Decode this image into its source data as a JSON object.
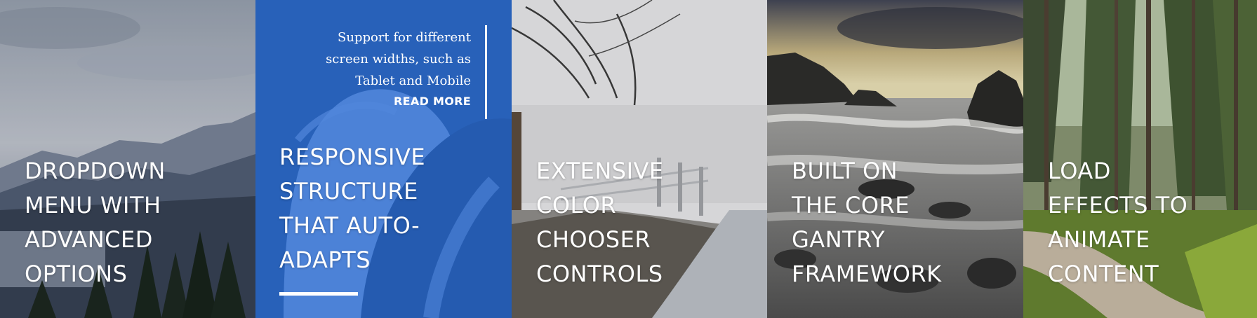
{
  "panels": [
    {
      "id": "p1",
      "title_lines": [
        "DROPDOWN",
        "MENU WITH",
        "ADVANCED",
        "OPTIONS"
      ],
      "scene": "mountain-lake-image"
    },
    {
      "id": "p2",
      "title_lines": [
        "RESPONSIVE",
        "STRUCTURE",
        "THAT AUTO-",
        "ADAPTS"
      ],
      "scene": "horse-image",
      "blurb_lines": [
        "Support for different",
        "screen widths, such as",
        "Tablet and Mobile"
      ],
      "read_more": "READ MORE",
      "overlay_color": "#2468d2"
    },
    {
      "id": "p3",
      "title_lines": [
        "EXTENSIVE",
        "COLOR",
        "CHOOSER",
        "CONTROLS"
      ],
      "scene": "foggy-path-image"
    },
    {
      "id": "p4",
      "title_lines": [
        "BUILT ON",
        "THE CORE",
        "GANTRY",
        "FRAMEWORK"
      ],
      "scene": "rocky-coast-image"
    },
    {
      "id": "p5",
      "title_lines": [
        "LOAD",
        "EFFECTS TO",
        "ANIMATE",
        "CONTENT"
      ],
      "scene": "forest-path-image"
    }
  ]
}
